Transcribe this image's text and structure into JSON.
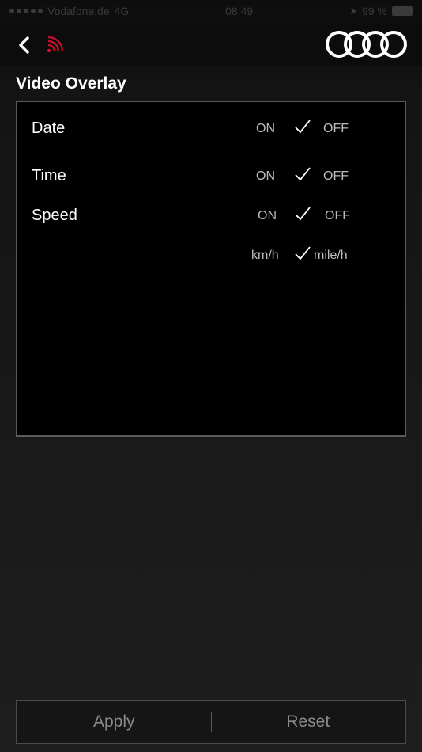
{
  "status_bar": {
    "carrier": "Vodafone.de",
    "network": "4G",
    "time": "08:49",
    "battery": "99 %"
  },
  "page": {
    "title": "Video Overlay"
  },
  "settings": [
    {
      "label": "Date",
      "left_option": "ON",
      "right_option": "OFF"
    },
    {
      "label": "Time",
      "left_option": "ON",
      "right_option": "OFF"
    },
    {
      "label": "Speed",
      "left_option": "ON",
      "right_option": "OFF"
    },
    {
      "label": "",
      "left_option": "km/h",
      "right_option": "mile/h"
    }
  ],
  "buttons": {
    "apply": "Apply",
    "reset": "Reset"
  },
  "colors": {
    "accent": "#c8102e",
    "background": "#1c1c1c",
    "panel": "#000000"
  }
}
